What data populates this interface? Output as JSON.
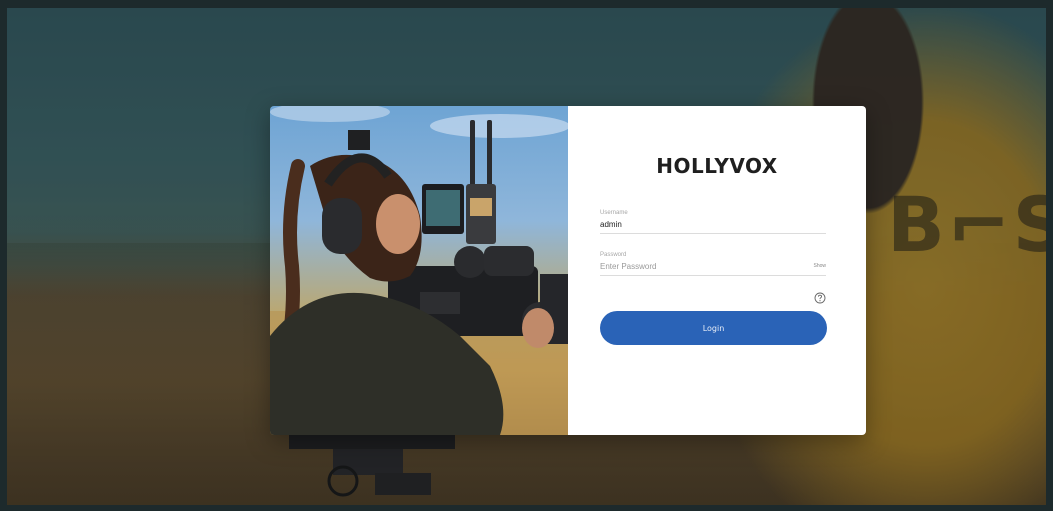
{
  "brand": {
    "logo_text": "HOLLYVOX"
  },
  "login_form": {
    "username": {
      "label": "Username",
      "value": "admin"
    },
    "password": {
      "label": "Password",
      "placeholder": "Enter Password",
      "show_label": "Show"
    },
    "help_icon": "question-circle-icon",
    "submit_label": "Login"
  },
  "colors": {
    "accent": "#2a63b7",
    "form_bg": "#ffffff",
    "text": "#1f1f1f"
  }
}
